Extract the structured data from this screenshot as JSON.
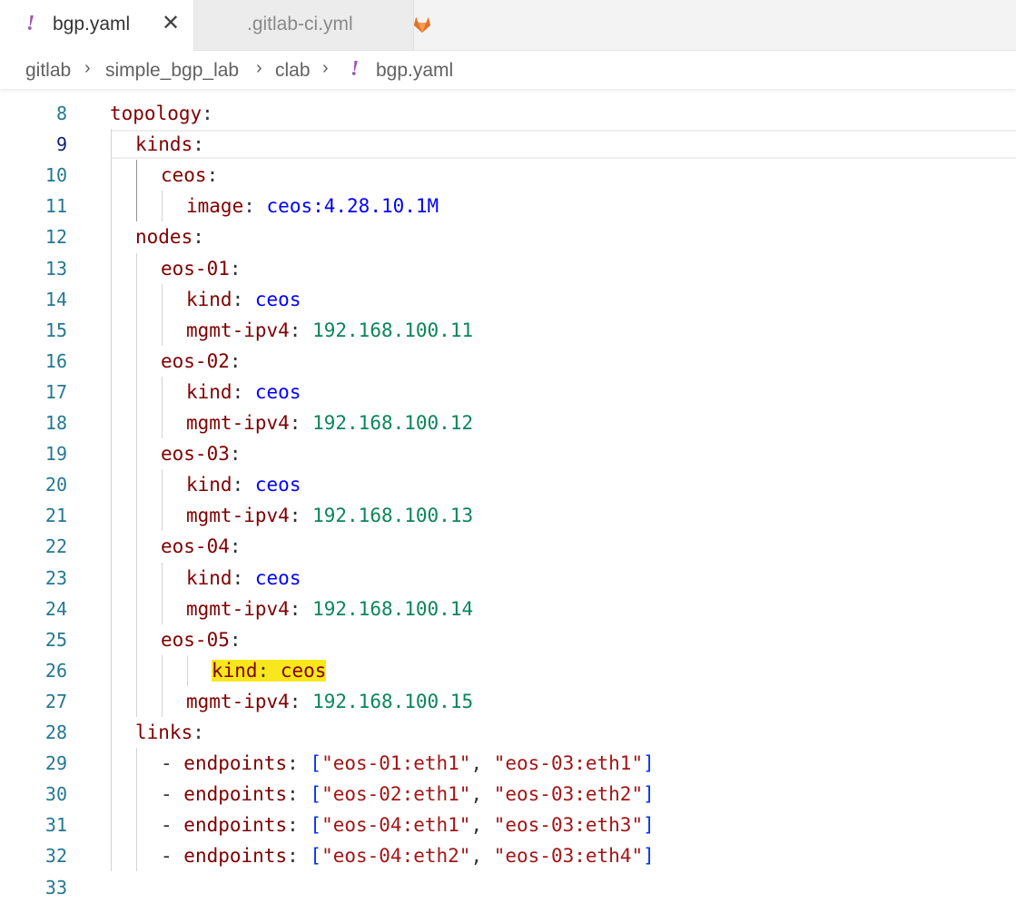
{
  "tabs": [
    {
      "label": "bgp.yaml",
      "icon": "yaml-icon",
      "active": true
    },
    {
      "label": ".gitlab-ci.yml",
      "icon": "gitlab-icon",
      "active": false
    }
  ],
  "close_glyph": "✕",
  "yaml_glyph": "!",
  "breadcrumb": [
    "gitlab",
    "simple_bgp_lab",
    "clab",
    "bgp.yaml"
  ],
  "colors": {
    "key": "#800000",
    "string": "#0000ff",
    "number": "#098658",
    "highlight": "#f8e71c",
    "yaml_icon": "#9b59b6",
    "gitlab_icon": "#e2732c"
  },
  "current_line": 9,
  "lines": [
    {
      "n": 8,
      "indent": 0,
      "key": "topology",
      "value": "",
      "vtype": ""
    },
    {
      "n": 9,
      "indent": 1,
      "key": "kinds",
      "value": "",
      "vtype": ""
    },
    {
      "n": 10,
      "indent": 2,
      "key": "ceos",
      "value": "",
      "vtype": ""
    },
    {
      "n": 11,
      "indent": 3,
      "key": "image",
      "value": "ceos:4.28.10.1M",
      "vtype": "s"
    },
    {
      "n": 12,
      "indent": 1,
      "key": "nodes",
      "value": "",
      "vtype": ""
    },
    {
      "n": 13,
      "indent": 2,
      "key": "eos-01",
      "value": "",
      "vtype": ""
    },
    {
      "n": 14,
      "indent": 3,
      "key": "kind",
      "value": "ceos",
      "vtype": "s"
    },
    {
      "n": 15,
      "indent": 3,
      "key": "mgmt-ipv4",
      "value": "192.168.100.11",
      "vtype": "n"
    },
    {
      "n": 16,
      "indent": 2,
      "key": "eos-02",
      "value": "",
      "vtype": ""
    },
    {
      "n": 17,
      "indent": 3,
      "key": "kind",
      "value": "ceos",
      "vtype": "s"
    },
    {
      "n": 18,
      "indent": 3,
      "key": "mgmt-ipv4",
      "value": "192.168.100.12",
      "vtype": "n"
    },
    {
      "n": 19,
      "indent": 2,
      "key": "eos-03",
      "value": "",
      "vtype": ""
    },
    {
      "n": 20,
      "indent": 3,
      "key": "kind",
      "value": "ceos",
      "vtype": "s"
    },
    {
      "n": 21,
      "indent": 3,
      "key": "mgmt-ipv4",
      "value": "192.168.100.13",
      "vtype": "n"
    },
    {
      "n": 22,
      "indent": 2,
      "key": "eos-04",
      "value": "",
      "vtype": ""
    },
    {
      "n": 23,
      "indent": 3,
      "key": "kind",
      "value": "ceos",
      "vtype": "s"
    },
    {
      "n": 24,
      "indent": 3,
      "key": "mgmt-ipv4",
      "value": "192.168.100.14",
      "vtype": "n"
    },
    {
      "n": 25,
      "indent": 2,
      "key": "eos-05",
      "value": "",
      "vtype": ""
    },
    {
      "n": 26,
      "indent": 4,
      "key": "kind",
      "value": "ceos",
      "vtype": "hl"
    },
    {
      "n": 27,
      "indent": 3,
      "key": "mgmt-ipv4",
      "value": "192.168.100.15",
      "vtype": "n"
    },
    {
      "n": 28,
      "indent": 1,
      "key": "links",
      "value": "",
      "vtype": ""
    },
    {
      "n": 29,
      "indent": 2,
      "key": "endpoints",
      "value": "",
      "vtype": "list",
      "dash": true,
      "items": [
        "\"eos-01:eth1\"",
        "\"eos-03:eth1\""
      ]
    },
    {
      "n": 30,
      "indent": 2,
      "key": "endpoints",
      "value": "",
      "vtype": "list",
      "dash": true,
      "items": [
        "\"eos-02:eth1\"",
        "\"eos-03:eth2\""
      ]
    },
    {
      "n": 31,
      "indent": 2,
      "key": "endpoints",
      "value": "",
      "vtype": "list",
      "dash": true,
      "items": [
        "\"eos-04:eth1\"",
        "\"eos-03:eth3\""
      ]
    },
    {
      "n": 32,
      "indent": 2,
      "key": "endpoints",
      "value": "",
      "vtype": "list",
      "dash": true,
      "items": [
        "\"eos-04:eth2\"",
        "\"eos-03:eth4\""
      ]
    },
    {
      "n": 33,
      "indent": 0,
      "key": "",
      "value": "",
      "vtype": ""
    }
  ]
}
